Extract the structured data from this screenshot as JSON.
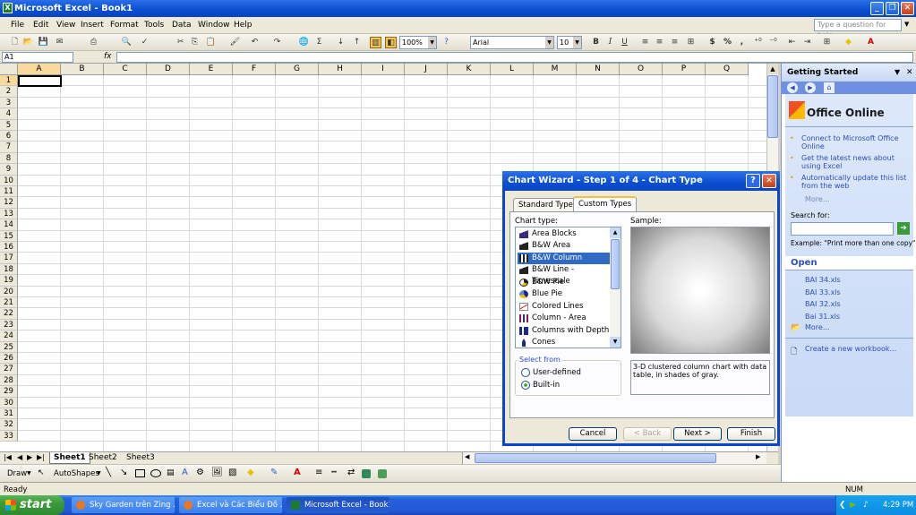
{
  "window": {
    "title": "Microsoft Excel - Book1",
    "minimize": "_",
    "restore": "❐",
    "close": "✕"
  },
  "menu": {
    "items": [
      "File",
      "Edit",
      "View",
      "Insert",
      "Format",
      "Tools",
      "Data",
      "Window",
      "Help"
    ],
    "question_placeholder": "Type a question for help"
  },
  "toolbar": {
    "zoom": "100%",
    "font": "Arial",
    "size": "10",
    "bold": "B",
    "italic": "I",
    "underline": "U",
    "currency": "$",
    "percent": "%",
    "comma": ","
  },
  "formula": {
    "name_box": "A1",
    "fx": "fx",
    "value": ""
  },
  "grid": {
    "columns": [
      "A",
      "B",
      "C",
      "D",
      "E",
      "F",
      "G",
      "H",
      "I",
      "J",
      "K",
      "L",
      "M",
      "N",
      "O",
      "P",
      "Q"
    ],
    "rows": [
      "1",
      "2",
      "3",
      "4",
      "5",
      "6",
      "7",
      "8",
      "9",
      "10",
      "11",
      "12",
      "13",
      "14",
      "15",
      "16",
      "17",
      "18",
      "19",
      "20",
      "21",
      "22",
      "23",
      "24",
      "25",
      "26",
      "27",
      "28",
      "29",
      "30",
      "31",
      "32",
      "33"
    ]
  },
  "sheets": [
    "Sheet1",
    "Sheet2",
    "Sheet3"
  ],
  "draw": {
    "draw_label": "Draw",
    "autoshapes_label": "AutoShapes"
  },
  "status": {
    "ready": "Ready",
    "num": "NUM"
  },
  "task_pane": {
    "title": "Getting Started",
    "office_online": "Office Online",
    "links": [
      "Connect to Microsoft Office Online",
      "Get the latest news about using Excel",
      "Automatically update this list from the web"
    ],
    "more": "More...",
    "search_label": "Search for:",
    "example": "Example: \"Print more than one copy\"",
    "open_title": "Open",
    "files": [
      "BAI 34.xls",
      "BAI 33.xls",
      "BAI 32.xls",
      "Bai 31.xls"
    ],
    "files_more": "More...",
    "create_new": "Create a new workbook..."
  },
  "dialog": {
    "title": "Chart Wizard - Step 1 of 4 - Chart Type",
    "help": "?",
    "close": "✕",
    "tabs": [
      "Standard Types",
      "Custom Types"
    ],
    "chart_type_label": "Chart type:",
    "sample_label": "Sample:",
    "chart_types": [
      "Area Blocks",
      "B&W Area",
      "B&W Column",
      "B&W Line - Timescale",
      "B&W Pie",
      "Blue Pie",
      "Colored Lines",
      "Column - Area",
      "Columns with Depth",
      "Cones"
    ],
    "selected_type": "B&W Column",
    "select_from": "Select from",
    "user_defined": "User-defined",
    "built_in": "Built-in",
    "description": "3-D clustered column chart with data table, in shades of gray.",
    "cancel": "Cancel",
    "back": "< Back",
    "next": "Next >",
    "finish": "Finish"
  },
  "taskbar": {
    "start": "start",
    "tasks": [
      "Sky Garden trên Zing ...",
      "Excel và Các Biểu Đồ ...",
      "Microsoft Excel - Book1"
    ],
    "time": "4:29 PM"
  }
}
